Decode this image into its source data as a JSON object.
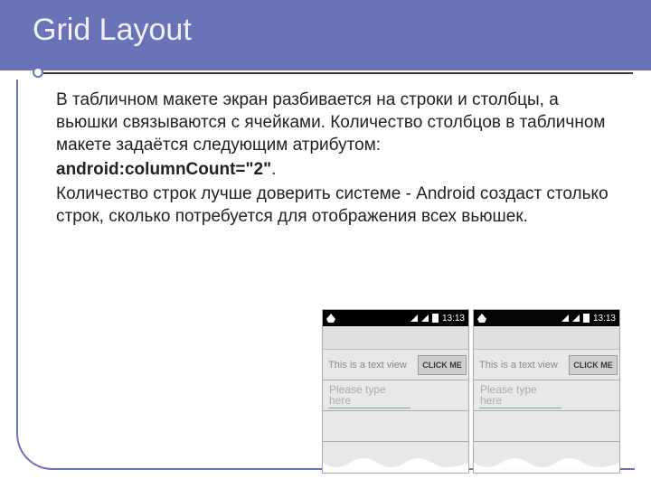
{
  "header": {
    "title": "Grid Layout"
  },
  "body": {
    "p1": "В табличном макете экран разбивается на строки и столбцы, а вьюшки связываются с ячейками. Количество столбцов в табличном макете задаётся следующим атрибутом:",
    "attr_line": "android:columnCount=\"2\"",
    "attr_suffix": ".",
    "p2": "Количество строк лучше доверить системе - Android создаст столько строк, сколько потребуется для отображения всех вьюшек."
  },
  "phone": {
    "time": "13:13",
    "textview_label": "This is a text view",
    "button_label": "CLICK ME",
    "input_placeholder": "Please type here"
  }
}
